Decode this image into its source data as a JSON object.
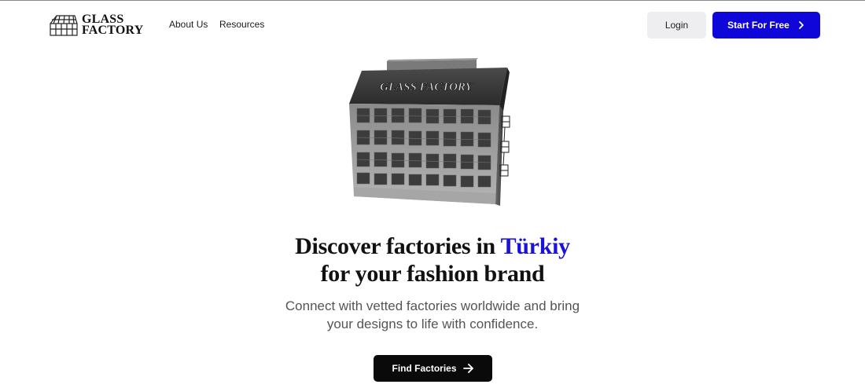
{
  "nav": {
    "logo_line1": "GLASS",
    "logo_line2": "FACTORY",
    "links": [
      "About Us",
      "Resources"
    ],
    "login_label": "Login",
    "start_label": "Start For Free"
  },
  "hero": {
    "building_sign": "GLASS FACTORY",
    "headline_part1": "Discover factories in ",
    "headline_accent": "Türkiy",
    "headline_line2": "for your fashion brand",
    "sub_line1": "Connect with vetted factories worldwide and bring",
    "sub_line2": "your designs to life with confidence.",
    "cta_label": "Find Factories"
  },
  "colors": {
    "brand_blue": "#0f07d9",
    "accent_text": "#1a12d6",
    "cta_black": "#0a0a0a"
  },
  "icons": {
    "logo": "greenhouse-logo-icon",
    "start_chevron": "chevron-right-icon",
    "cta_arrow": "arrow-right-icon"
  }
}
